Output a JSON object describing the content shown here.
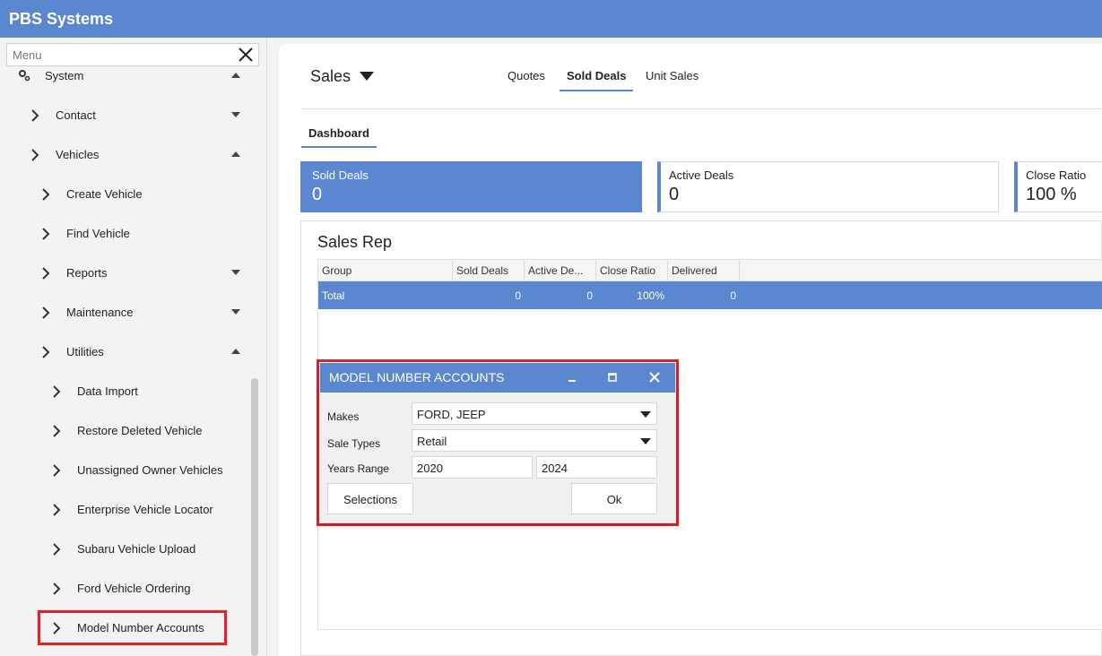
{
  "app": {
    "title": "PBS Systems"
  },
  "sidebar": {
    "search_placeholder": "Menu",
    "items": [
      {
        "label": "System"
      },
      {
        "label": "Contact"
      },
      {
        "label": "Vehicles"
      },
      {
        "label": "Create Vehicle"
      },
      {
        "label": "Find Vehicle"
      },
      {
        "label": "Reports"
      },
      {
        "label": "Maintenance"
      },
      {
        "label": "Utilities"
      },
      {
        "label": "Data Import"
      },
      {
        "label": "Restore Deleted Vehicle"
      },
      {
        "label": "Unassigned Owner Vehicles"
      },
      {
        "label": "Enterprise Vehicle Locator"
      },
      {
        "label": "Subaru Vehicle Upload"
      },
      {
        "label": "Ford Vehicle Ordering"
      },
      {
        "label": "Model Number Accounts"
      }
    ]
  },
  "main": {
    "title": "Sales",
    "tabs": [
      {
        "label": "Quotes"
      },
      {
        "label": "Sold Deals"
      },
      {
        "label": "Unit Sales"
      }
    ],
    "active_tab": "Sold Deals",
    "subtab": "Dashboard",
    "kpis": [
      {
        "label": "Sold Deals",
        "value": "0"
      },
      {
        "label": "Active Deals",
        "value": "0"
      },
      {
        "label": "Close Ratio",
        "value": "100 %"
      }
    ],
    "sales_rep": {
      "title": "Sales Rep",
      "columns": [
        "Group",
        "Sold Deals",
        "Active De...",
        "Close Ratio",
        "Delivered"
      ],
      "rows": [
        {
          "group": "Total",
          "sold_deals": "0",
          "active_deals": "0",
          "close_ratio": "100%",
          "delivered": "0"
        }
      ]
    }
  },
  "modal": {
    "title": "MODEL NUMBER ACCOUNTS",
    "makes_label": "Makes",
    "makes_value": "FORD, JEEP",
    "sale_types_label": "Sale Types",
    "sale_types_value": "Retail",
    "years_label": "Years Range",
    "year_from": "2020",
    "year_to": "2024",
    "selections_button": "Selections",
    "ok_button": "Ok"
  },
  "colors": {
    "accent": "#5b87d0",
    "highlight": "#d9262c"
  }
}
